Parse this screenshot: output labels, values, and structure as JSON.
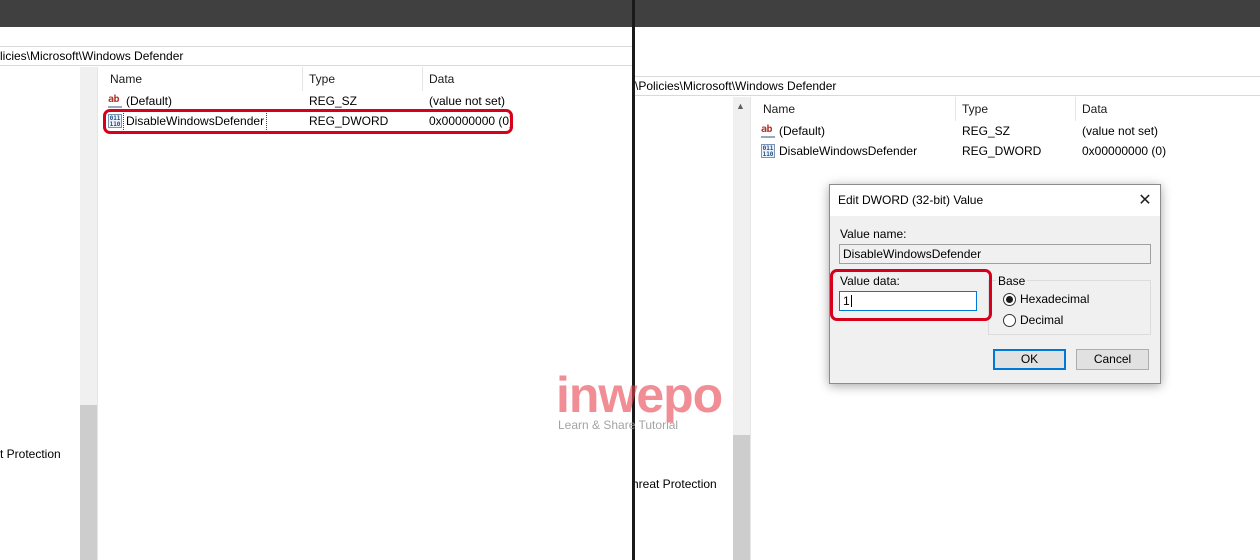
{
  "left": {
    "address": "licies\\Microsoft\\Windows Defender",
    "tree_item": "t Protection",
    "columns": {
      "name": "Name",
      "type": "Type",
      "data": "Data"
    },
    "rows": [
      {
        "icon": "ab",
        "name": "(Default)",
        "type": "REG_SZ",
        "data": "(value not set)"
      },
      {
        "icon": "011\n110",
        "name": "DisableWindowsDefender",
        "type": "REG_DWORD",
        "data": "0x00000000 (0)"
      }
    ]
  },
  "right": {
    "address": "\\Policies\\Microsoft\\Windows Defender",
    "tree_item": "hreat Protection",
    "columns": {
      "name": "Name",
      "type": "Type",
      "data": "Data"
    },
    "rows": [
      {
        "icon": "ab",
        "name": "(Default)",
        "type": "REG_SZ",
        "data": "(value not set)"
      },
      {
        "icon": "011\n110",
        "name": "DisableWindowsDefender",
        "type": "REG_DWORD",
        "data": "0x00000000 (0)"
      }
    ]
  },
  "dialog": {
    "title": "Edit DWORD (32-bit) Value",
    "close_glyph": "✕",
    "value_name_label": "Value name:",
    "value_name": "DisableWindowsDefender",
    "value_data_label": "Value data:",
    "value_data": "1",
    "base_label": "Base",
    "base_options": [
      {
        "label": "Hexadecimal",
        "selected": true
      },
      {
        "label": "Decimal",
        "selected": false
      }
    ],
    "ok_label": "OK",
    "cancel_label": "Cancel"
  },
  "watermark": {
    "logo": "inwepo",
    "tagline": "Learn & Share Tutorial"
  },
  "colors": {
    "highlight": "#d6001c",
    "titlebar": "#404040",
    "focus_blue": "#0078d7",
    "watermark": "#e8434f"
  }
}
